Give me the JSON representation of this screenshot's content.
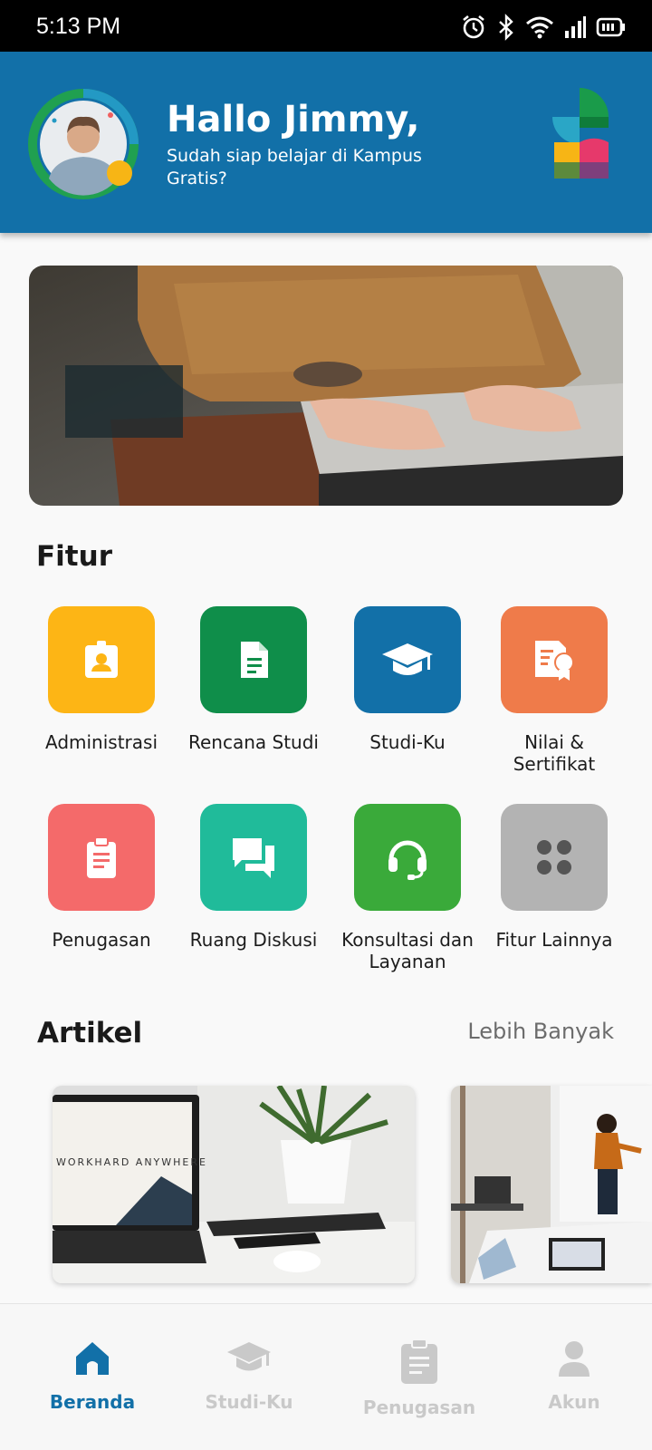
{
  "status_bar": {
    "time": "5:13 PM"
  },
  "header": {
    "greeting": "Hallo Jimmy,",
    "subtitle": "Sudah siap belajar di Kampus Gratis?"
  },
  "features": {
    "title": "Fitur",
    "items": [
      {
        "label": "Administrasi",
        "icon": "id-badge-icon",
        "color": "#fdb515"
      },
      {
        "label": "Rencana Studi",
        "icon": "document-icon",
        "color": "#0f8e4a"
      },
      {
        "label": "Studi-Ku",
        "icon": "graduation-cap-icon",
        "color": "#1270a8"
      },
      {
        "label": "Nilai & Sertifikat",
        "icon": "certificate-icon",
        "color": "#ef7b4a"
      },
      {
        "label": "Penugasan",
        "icon": "clipboard-icon",
        "color": "#f46a6a"
      },
      {
        "label": "Ruang Diskusi",
        "icon": "chat-icon",
        "color": "#20bb9a"
      },
      {
        "label": "Konsultasi dan Layanan",
        "icon": "headset-icon",
        "color": "#3aaa3a"
      },
      {
        "label": "Fitur Lainnya",
        "icon": "grid-icon",
        "color": "#b3b3b3"
      }
    ]
  },
  "articles": {
    "title": "Artikel",
    "more_label": "Lebih Banyak",
    "card1_screen_text": "WORKHARD ANYWHERE"
  },
  "bottom_nav": {
    "items": [
      {
        "label": "Beranda",
        "icon": "home-icon",
        "active": true
      },
      {
        "label": "Studi-Ku",
        "icon": "graduation-cap-icon",
        "active": false
      },
      {
        "label": "Penugasan",
        "icon": "clipboard-icon",
        "active": false
      },
      {
        "label": "Akun",
        "icon": "user-icon",
        "active": false
      }
    ]
  },
  "colors": {
    "primary": "#1270a8",
    "background": "#f9f9f9"
  }
}
